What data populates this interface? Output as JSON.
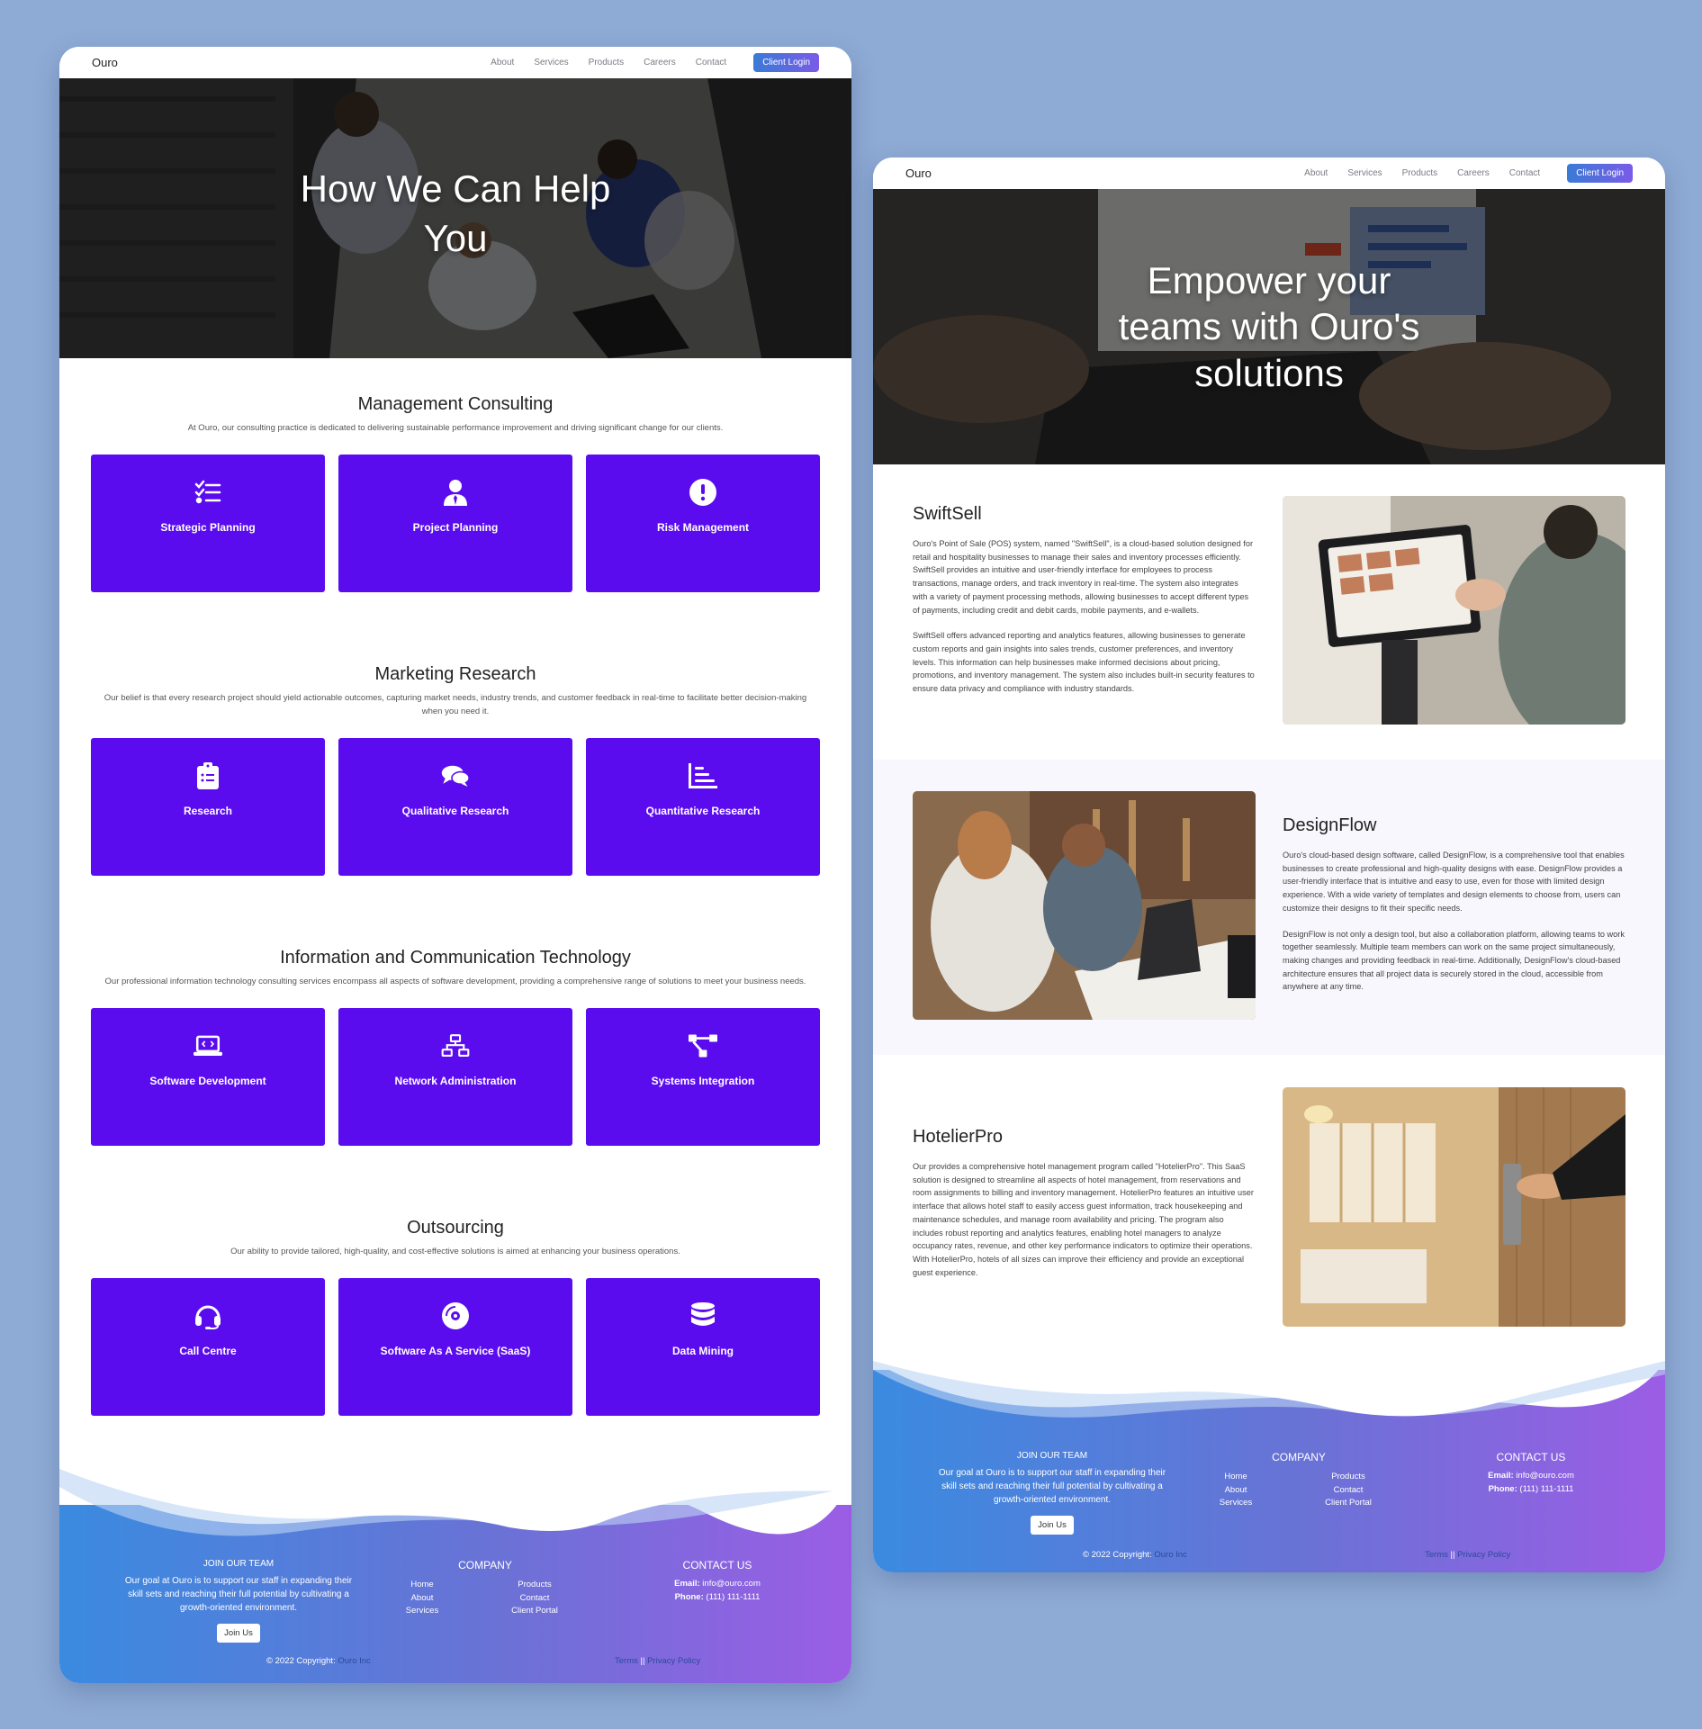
{
  "nav": {
    "brand": "Ouro",
    "links": [
      "About",
      "Services",
      "Products",
      "Careers",
      "Contact"
    ],
    "login": "Client Login"
  },
  "left_page": {
    "hero_title": "How We Can Help You",
    "sections": [
      {
        "title": "Management Consulting",
        "desc": "At Ouro, our consulting practice is dedicated to delivering sustainable performance improvement and driving significant change for our clients.",
        "cards": [
          {
            "label": "Strategic Planning",
            "icon": "checklist-icon"
          },
          {
            "label": "Project Planning",
            "icon": "user-tie-icon"
          },
          {
            "label": "Risk Management",
            "icon": "exclamation-circle-icon"
          }
        ]
      },
      {
        "title": "Marketing Research",
        "desc": "Our belief is that every research project should yield actionable outcomes, capturing market needs, industry trends, and customer feedback in real-time to facilitate better decision-making when you need it.",
        "cards": [
          {
            "label": "Research",
            "icon": "clipboard-list-icon"
          },
          {
            "label": "Qualitative Research",
            "icon": "comments-icon"
          },
          {
            "label": "Quantitative Research",
            "icon": "chart-bars-icon"
          }
        ]
      },
      {
        "title": "Information and Communication Technology",
        "desc": "Our professional information technology consulting services encompass all aspects of software development, providing a comprehensive range of solutions to meet your business needs.",
        "cards": [
          {
            "label": "Software Development",
            "icon": "laptop-code-icon"
          },
          {
            "label": "Network Administration",
            "icon": "network-icon"
          },
          {
            "label": "Systems Integration",
            "icon": "diagram-project-icon"
          }
        ]
      },
      {
        "title": "Outsourcing",
        "desc": "Our ability to provide tailored, high-quality, and cost-effective solutions is aimed at enhancing your business operations.",
        "cards": [
          {
            "label": "Call Centre",
            "icon": "headset-icon"
          },
          {
            "label": "Software As A Service (SaaS)",
            "icon": "compact-disc-icon"
          },
          {
            "label": "Data Mining",
            "icon": "database-icon"
          }
        ]
      }
    ]
  },
  "right_page": {
    "hero_title": "Empower your teams with Ouro's solutions",
    "products": [
      {
        "name": "SwiftSell",
        "p1": "Ouro's Point of Sale (POS) system, named \"SwiftSell\", is a cloud-based solution designed for retail and hospitality businesses to manage their sales and inventory processes efficiently. SwiftSell provides an intuitive and user-friendly interface for employees to process transactions, manage orders, and track inventory in real-time. The system also integrates with a variety of payment processing methods, allowing businesses to accept different types of payments, including credit and debit cards, mobile payments, and e-wallets.",
        "p2": "SwiftSell offers advanced reporting and analytics features, allowing businesses to generate custom reports and gain insights into sales trends, customer preferences, and inventory levels. This information can help businesses make informed decisions about pricing, promotions, and inventory management. The system also includes built-in security features to ensure data privacy and compliance with industry standards."
      },
      {
        "name": "DesignFlow",
        "p1": "Ouro's cloud-based design software, called DesignFlow, is a comprehensive tool that enables businesses to create professional and high-quality designs with ease. DesignFlow provides a user-friendly interface that is intuitive and easy to use, even for those with limited design experience. With a wide variety of templates and design elements to choose from, users can customize their designs to fit their specific needs.",
        "p2": "DesignFlow is not only a design tool, but also a collaboration platform, allowing teams to work together seamlessly. Multiple team members can work on the same project simultaneously, making changes and providing feedback in real-time. Additionally, DesignFlow's cloud-based architecture ensures that all project data is securely stored in the cloud, accessible from anywhere at any time."
      },
      {
        "name": "HotelierPro",
        "p1": "Our provides a comprehensive hotel management program called \"HotelierPro\". This SaaS solution is designed to streamline all aspects of hotel management, from reservations and room assignments to billing and inventory management. HotelierPro features an intuitive user interface that allows hotel staff to easily access guest information, track housekeeping and maintenance schedules, and manage room availability and pricing. The program also includes robust reporting and analytics features, enabling hotel managers to analyze occupancy rates, revenue, and other key performance indicators to optimize their operations. With HotelierPro, hotels of all sizes can improve their efficiency and provide an exceptional guest experience."
      }
    ]
  },
  "footer": {
    "join_title": "JOIN OUR TEAM",
    "join_text": "Our goal at Ouro is to support our staff in expanding their skill sets and reaching their full potential by cultivating a growth-oriented environment.",
    "join_button": "Join Us",
    "company_title": "COMPANY",
    "company_links_col1": [
      "Home",
      "About",
      "Services"
    ],
    "company_links_col2": [
      "Products",
      "Contact",
      "Client Portal"
    ],
    "contact_title": "CONTACT US",
    "email_label": "Email:",
    "email": "info@ouro.com",
    "phone_label": "Phone:",
    "phone": "(111) 111-1111",
    "copyright_prefix": "© 2022 Copyright:",
    "copyright_company": "Ouro Inc",
    "terms": "Terms",
    "separator": "||",
    "privacy": "Privacy Policy"
  },
  "colors": {
    "background": "#8eabd5",
    "card_purple": "#5b0cef",
    "footer_gradient_start": "#3a8be0",
    "footer_gradient_end": "#9b5de5"
  }
}
